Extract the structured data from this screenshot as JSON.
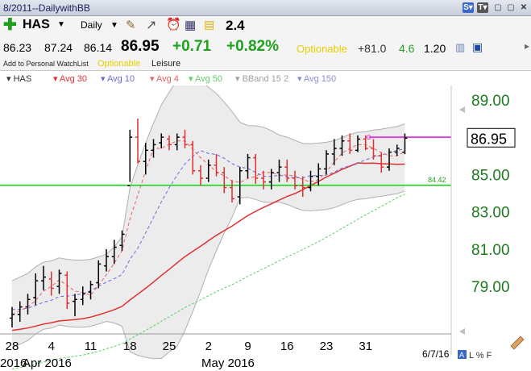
{
  "window": {
    "title": "8/2011--DailywithBB"
  },
  "toolbar": {
    "symbol": "HAS",
    "period": "Daily",
    "ratio": "2.4"
  },
  "quote": {
    "open": "86.23",
    "high": "87.24",
    "low": "86.14",
    "last": "86.95",
    "change": "+0.71",
    "change_pct": "+0.82%",
    "optionable_label": "Optionable",
    "opt_value": "+81.0",
    "val2": "4.6",
    "val3": "1.20"
  },
  "watchlist": {
    "add_label": "Add to Personal WatchList",
    "optionable": "Optionable",
    "sector": "Leisure"
  },
  "legend": [
    {
      "label": "HAS",
      "color": "#333333"
    },
    {
      "label": "Avg 30",
      "color": "#e03030"
    },
    {
      "label": "Avg 10",
      "color": "#6a6ae0"
    },
    {
      "label": "Avg 4",
      "color": "#e86060"
    },
    {
      "label": "Avg 50",
      "color": "#66cc66"
    },
    {
      "label": "BBand 15 2",
      "color": "#a0a0a0"
    },
    {
      "label": "Avg 150",
      "color": "#8a8ad8"
    }
  ],
  "colors": {
    "up": "#e03030",
    "down": "#000000",
    "price_axis": "#1e7a1e",
    "hline": "#00dd00",
    "magenta": "#dd44dd"
  },
  "chart_data": {
    "type": "ohlc",
    "y_ticks": [
      "89.00",
      "87.00",
      "85.00",
      "83.00",
      "81.00",
      "79.00"
    ],
    "y_tick_values": [
      89,
      87,
      85,
      83,
      81,
      79
    ],
    "ylim": [
      76.8,
      89.6
    ],
    "x_labels": [
      {
        "label": "28",
        "i": 0
      },
      {
        "label": "4",
        "i": 5
      },
      {
        "label": "11",
        "i": 10
      },
      {
        "label": "18",
        "i": 15
      },
      {
        "label": "25",
        "i": 20
      },
      {
        "label": "2",
        "i": 25
      },
      {
        "label": "9",
        "i": 30
      },
      {
        "label": "16",
        "i": 35
      },
      {
        "label": "23",
        "i": 40
      },
      {
        "label": "31",
        "i": 45
      }
    ],
    "month_labels": [
      "2016",
      "Apr 2016",
      "May 2016"
    ],
    "date_stamp": "6/7/16",
    "last_price_label": "86.95",
    "horizontal_line": {
      "value": 84.42,
      "label": "84.42"
    },
    "magenta_line": {
      "value": 87.0
    },
    "bars": [
      {
        "o": 77.3,
        "h": 77.9,
        "l": 76.8,
        "c": 77.5
      },
      {
        "o": 77.5,
        "h": 78.2,
        "l": 77.1,
        "c": 77.9
      },
      {
        "o": 77.9,
        "h": 78.6,
        "l": 77.5,
        "c": 78.3
      },
      {
        "o": 78.4,
        "h": 79.7,
        "l": 78.0,
        "c": 79.3
      },
      {
        "o": 79.3,
        "h": 80.1,
        "l": 78.8,
        "c": 79.5
      },
      {
        "o": 79.4,
        "h": 79.8,
        "l": 78.5,
        "c": 78.9
      },
      {
        "o": 79.0,
        "h": 79.9,
        "l": 78.6,
        "c": 79.7
      },
      {
        "o": 79.6,
        "h": 79.8,
        "l": 77.8,
        "c": 78.1
      },
      {
        "o": 78.2,
        "h": 78.6,
        "l": 77.4,
        "c": 78.3
      },
      {
        "o": 78.3,
        "h": 79.0,
        "l": 78.0,
        "c": 78.6
      },
      {
        "o": 78.7,
        "h": 79.3,
        "l": 78.3,
        "c": 79.1
      },
      {
        "o": 79.2,
        "h": 80.4,
        "l": 78.9,
        "c": 80.2
      },
      {
        "o": 80.1,
        "h": 81.0,
        "l": 79.8,
        "c": 80.6
      },
      {
        "o": 80.6,
        "h": 81.5,
        "l": 80.2,
        "c": 81.1
      },
      {
        "o": 81.2,
        "h": 82.0,
        "l": 80.9,
        "c": 81.8
      },
      {
        "o": 84.4,
        "h": 87.4,
        "l": 84.6,
        "c": 87.0
      },
      {
        "o": 87.0,
        "h": 88.0,
        "l": 85.6,
        "c": 85.7
      },
      {
        "o": 85.7,
        "h": 86.7,
        "l": 85.0,
        "c": 86.3
      },
      {
        "o": 86.3,
        "h": 86.9,
        "l": 85.9,
        "c": 86.6
      },
      {
        "o": 86.7,
        "h": 87.2,
        "l": 86.4,
        "c": 87.0
      },
      {
        "o": 86.9,
        "h": 87.1,
        "l": 86.3,
        "c": 86.6
      },
      {
        "o": 86.6,
        "h": 87.2,
        "l": 86.3,
        "c": 87.0
      },
      {
        "o": 87.0,
        "h": 87.4,
        "l": 86.4,
        "c": 86.6
      },
      {
        "o": 86.6,
        "h": 86.8,
        "l": 85.0,
        "c": 85.2
      },
      {
        "o": 85.2,
        "h": 85.5,
        "l": 84.4,
        "c": 84.8
      },
      {
        "o": 84.8,
        "h": 85.8,
        "l": 84.6,
        "c": 85.5
      },
      {
        "o": 85.5,
        "h": 86.1,
        "l": 84.9,
        "c": 85.1
      },
      {
        "o": 85.1,
        "h": 85.4,
        "l": 84.0,
        "c": 84.3
      },
      {
        "o": 84.3,
        "h": 84.7,
        "l": 83.5,
        "c": 83.7
      },
      {
        "o": 83.8,
        "h": 85.4,
        "l": 83.4,
        "c": 85.2
      },
      {
        "o": 85.2,
        "h": 86.1,
        "l": 84.8,
        "c": 85.9
      },
      {
        "o": 85.9,
        "h": 86.1,
        "l": 84.5,
        "c": 84.8
      },
      {
        "o": 84.8,
        "h": 85.2,
        "l": 84.2,
        "c": 84.6
      },
      {
        "o": 84.6,
        "h": 85.3,
        "l": 84.2,
        "c": 85.1
      },
      {
        "o": 85.1,
        "h": 85.8,
        "l": 84.6,
        "c": 85.4
      },
      {
        "o": 85.4,
        "h": 85.8,
        "l": 84.6,
        "c": 84.8
      },
      {
        "o": 84.8,
        "h": 85.2,
        "l": 84.2,
        "c": 84.4
      },
      {
        "o": 84.4,
        "h": 84.9,
        "l": 83.8,
        "c": 84.3
      },
      {
        "o": 84.3,
        "h": 85.2,
        "l": 84.1,
        "c": 84.9
      },
      {
        "o": 84.9,
        "h": 85.6,
        "l": 84.4,
        "c": 85.3
      },
      {
        "o": 85.3,
        "h": 86.3,
        "l": 85.0,
        "c": 86.1
      },
      {
        "o": 86.1,
        "h": 86.9,
        "l": 85.5,
        "c": 86.4
      },
      {
        "o": 86.4,
        "h": 87.1,
        "l": 86.0,
        "c": 86.8
      },
      {
        "o": 86.8,
        "h": 87.2,
        "l": 86.1,
        "c": 86.3
      },
      {
        "o": 86.3,
        "h": 87.1,
        "l": 86.2,
        "c": 86.9
      },
      {
        "o": 86.9,
        "h": 87.1,
        "l": 86.3,
        "c": 86.4
      },
      {
        "o": 86.4,
        "h": 86.9,
        "l": 85.8,
        "c": 86.0
      },
      {
        "o": 86.0,
        "h": 86.2,
        "l": 85.1,
        "c": 85.4
      },
      {
        "o": 85.4,
        "h": 86.4,
        "l": 85.2,
        "c": 86.2
      },
      {
        "o": 86.2,
        "h": 86.6,
        "l": 86.0,
        "c": 86.4
      },
      {
        "o": 86.2,
        "h": 87.2,
        "l": 86.1,
        "c": 86.95
      }
    ]
  }
}
